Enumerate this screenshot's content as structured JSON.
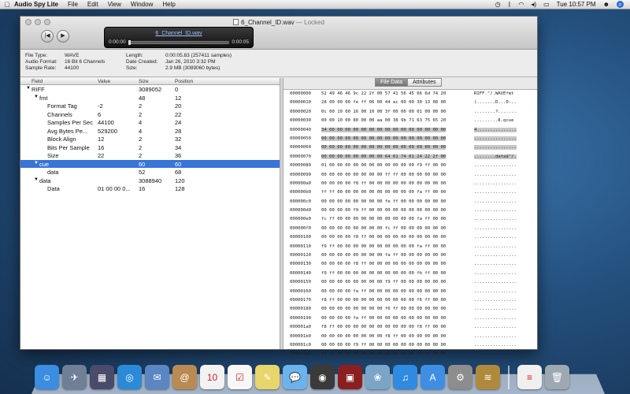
{
  "menubar": {
    "app_name": "Audio Spy Lite",
    "menus": [
      "File",
      "Edit",
      "View",
      "Window",
      "Help"
    ],
    "clock": "Tue 10:57 PM"
  },
  "window": {
    "title": "6_Channel_ID.wav",
    "title_suffix": "— Locked"
  },
  "player": {
    "file_name": "6_Channel_ID.wav",
    "current_time": "0:00:00",
    "total_time": "0:00:05",
    "progress": 0.0
  },
  "info": {
    "file_type_label": "File Type:",
    "file_type": "WAVE",
    "audio_format_label": "Audio Format:",
    "audio_format": "16 Bit 6 Channels",
    "sample_rate_label": "Sample Rate:",
    "sample_rate": "44100",
    "length_label": "Length:",
    "length": "0:00:05.83 (257411 samples)",
    "date_label": "Date Created:",
    "date": "Jan 26, 2010 3:32 PM",
    "size_label": "Size:",
    "size": "2.9 MB (3089060 bytes)"
  },
  "tree": {
    "columns": [
      "Field",
      "Value",
      "Size",
      "Position"
    ],
    "rows": [
      {
        "field": "RIFF",
        "value": "",
        "size": "3089052",
        "position": "0",
        "indent": 0,
        "toggle": "▼"
      },
      {
        "field": "fmt",
        "value": "",
        "size": "48",
        "position": "12",
        "indent": 1,
        "toggle": "▼"
      },
      {
        "field": "Format Tag",
        "value": "-2",
        "size": "2",
        "position": "20",
        "indent": 2,
        "toggle": ""
      },
      {
        "field": "Channels",
        "value": "6",
        "size": "2",
        "position": "22",
        "indent": 2,
        "toggle": ""
      },
      {
        "field": "Samples Per Sec",
        "value": "44100",
        "size": "4",
        "position": "24",
        "indent": 2,
        "toggle": ""
      },
      {
        "field": "Avg Bytes Pe...",
        "value": "529200",
        "size": "4",
        "position": "28",
        "indent": 2,
        "toggle": ""
      },
      {
        "field": "Block Align",
        "value": "12",
        "size": "2",
        "position": "32",
        "indent": 2,
        "toggle": ""
      },
      {
        "field": "Bits Per Sample",
        "value": "16",
        "size": "2",
        "position": "34",
        "indent": 2,
        "toggle": ""
      },
      {
        "field": "Size",
        "value": "22",
        "size": "2",
        "position": "36",
        "indent": 2,
        "toggle": ""
      },
      {
        "field": "cue",
        "value": "",
        "size": "60",
        "position": "60",
        "indent": 1,
        "toggle": "▼",
        "selected": true
      },
      {
        "field": "data",
        "value": "",
        "size": "52",
        "position": "68",
        "indent": 2,
        "toggle": ""
      },
      {
        "field": "data",
        "value": "",
        "size": "3088940",
        "position": "120",
        "indent": 1,
        "toggle": "▼"
      },
      {
        "field": "Data",
        "value": "01 00 00 0...",
        "size": "16",
        "position": "128",
        "indent": 2,
        "toggle": ""
      }
    ]
  },
  "tabs": {
    "file_data": "File Data",
    "attributes": "Attributes"
  },
  "hex": {
    "rows": [
      {
        "offset": "00000000",
        "bytes": "52 49 46 46 9c 22 2f 00 57 41 56 45 66 6d 74 20",
        "ascii": "RIFF.\"/.WAVEfmt "
      },
      {
        "offset": "00000010",
        "bytes": "28 00 00 00 fe ff 06 00 44 ac 00 00 30 13 08 00",
        "ascii": "(.......D...0..."
      },
      {
        "offset": "00000020",
        "bytes": "0c 00 10 00 16 00 10 00 3f 00 00 00 01 00 00 00",
        "ascii": "........?......."
      },
      {
        "offset": "00000030",
        "bytes": "00 00 10 00 80 00 00 aa 00 38 9b 71 63 75 65 20",
        "ascii": ".........8.qcue "
      },
      {
        "offset": "00000040",
        "bytes": "34 00 00 00 00 00 00 00 00 00 00 00 00 00 00 00",
        "ascii": "4..............."
      },
      {
        "offset": "00000050",
        "bytes": "00 00 00 00 00 00 00 00 00 00 00 00 00 00 00 00",
        "ascii": "................"
      },
      {
        "offset": "00000060",
        "bytes": "00 00 00 00 00 00 00 00 00 00 00 00 00 00 00 00",
        "ascii": "................"
      },
      {
        "offset": "00000070",
        "bytes": "00 00 00 00 00 00 00 00 64 61 74 61 24 22 2f 00",
        "ascii": "........data$\"/."
      },
      {
        "offset": "00000080",
        "bytes": "01 00 00 00 00 00 00 00 00 00 00 00 f9 ff 00 00",
        "ascii": "................"
      },
      {
        "offset": "00000090",
        "bytes": "00 00 00 00 00 00 00 00 ff ff 00 00 00 00 00 00",
        "ascii": "................"
      },
      {
        "offset": "000000a0",
        "bytes": "00 00 00 00 f8 ff 00 00 00 00 00 00 00 00 00 00",
        "ascii": "................"
      },
      {
        "offset": "000000b0",
        "bytes": "ff ff 00 00 00 00 00 00 00 00 00 00 fa ff 00 00",
        "ascii": "................"
      },
      {
        "offset": "000000c0",
        "bytes": "00 00 00 00 00 00 00 00 fe ff 00 00 00 00 00 00",
        "ascii": "................"
      },
      {
        "offset": "000000d0",
        "bytes": "00 00 00 00 f9 ff 00 00 00 00 00 00 00 00 00 00",
        "ascii": "................"
      },
      {
        "offset": "000000e0",
        "bytes": "fc ff 00 00 00 00 00 00 00 00 00 00 fa ff 00 00",
        "ascii": "................"
      },
      {
        "offset": "000000f0",
        "bytes": "00 00 00 00 00 00 00 00 fc ff 00 00 00 00 00 00",
        "ascii": "................"
      },
      {
        "offset": "00000100",
        "bytes": "00 00 00 00 f8 ff 00 00 00 00 00 00 00 00 00 00",
        "ascii": "................"
      },
      {
        "offset": "00000110",
        "bytes": "f9 ff 00 00 00 00 00 00 00 00 00 00 fa ff 00 00",
        "ascii": "................"
      },
      {
        "offset": "00000120",
        "bytes": "00 00 00 00 00 00 00 00 fa ff 00 00 00 00 00 00",
        "ascii": "................"
      },
      {
        "offset": "00000130",
        "bytes": "00 00 00 00 f8 ff 00 00 00 00 00 00 00 00 00 00",
        "ascii": "................"
      },
      {
        "offset": "00000140",
        "bytes": "f9 ff 00 00 00 00 00 00 00 00 00 00 fb ff 00 00",
        "ascii": "................"
      },
      {
        "offset": "00000150",
        "bytes": "00 00 00 00 00 00 00 00 f9 ff 00 00 00 00 00 00",
        "ascii": "................"
      },
      {
        "offset": "00000160",
        "bytes": "00 00 00 00 fa ff 00 00 00 00 00 00 00 00 00 00",
        "ascii": "................"
      },
      {
        "offset": "00000170",
        "bytes": "f8 ff 00 00 00 00 00 00 00 00 00 00 f6 ff 00 00",
        "ascii": "................"
      },
      {
        "offset": "00000180",
        "bytes": "00 00 00 00 00 00 00 00 f6 ff 00 00 00 00 00 00",
        "ascii": "................"
      },
      {
        "offset": "00000190",
        "bytes": "00 00 00 00 fa ff 00 00 00 00 00 00 00 00 00 00",
        "ascii": "................"
      },
      {
        "offset": "000001a0",
        "bytes": "f8 ff 00 00 00 00 00 00 00 00 00 00 f8 ff 00 00",
        "ascii": "................"
      },
      {
        "offset": "000001b0",
        "bytes": "00 00 00 00 00 00 00 00 f8 ff 00 00 00 00 00 00",
        "ascii": "................"
      },
      {
        "offset": "000001c0",
        "bytes": "00 00 00 00 f9 ff 00 00 00 00 00 00 00 00 00 00",
        "ascii": "................"
      },
      {
        "offset": "000001d0",
        "bytes": "f8 ff 00 00 00 00 00 00 00 00 00 00 f9 ff 00 00",
        "ascii": "................"
      }
    ],
    "highlight_rows": [
      4,
      5,
      6,
      7
    ]
  },
  "dock": {
    "items": [
      {
        "name": "finder-icon",
        "color": "#3a8de0",
        "glyph": "☺"
      },
      {
        "name": "launchpad-icon",
        "color": "#6f7f95",
        "glyph": "✈"
      },
      {
        "name": "mission-control-icon",
        "color": "#4a4a6a",
        "glyph": "▦"
      },
      {
        "name": "safari-icon",
        "color": "#2b8ad8",
        "glyph": "◎"
      },
      {
        "name": "mail-icon",
        "color": "#5b86c2",
        "glyph": "✉"
      },
      {
        "name": "contacts-icon",
        "color": "#b98b52",
        "glyph": "@"
      },
      {
        "name": "calendar-icon",
        "color": "#f2f2f2",
        "glyph": "10"
      },
      {
        "name": "reminders-icon",
        "color": "#f7f7f7",
        "glyph": "☑"
      },
      {
        "name": "notes-icon",
        "color": "#e8d56b",
        "glyph": "✎"
      },
      {
        "name": "messages-icon",
        "color": "#6ab3ec",
        "glyph": "💬"
      },
      {
        "name": "facetime-icon",
        "color": "#3a3a3a",
        "glyph": "◉"
      },
      {
        "name": "photo-booth-icon",
        "color": "#8b1f1f",
        "glyph": "▣"
      },
      {
        "name": "iphoto-icon",
        "color": "#7aa5c9",
        "glyph": "❀"
      },
      {
        "name": "itunes-icon",
        "color": "#2f8be0",
        "glyph": "♫"
      },
      {
        "name": "app-store-icon",
        "color": "#3e8fe3",
        "glyph": "A"
      },
      {
        "name": "system-preferences-icon",
        "color": "#8d8d8d",
        "glyph": "⚙"
      },
      {
        "name": "audio-spy-icon",
        "color": "#b08a3c",
        "glyph": "≋"
      },
      {
        "name": "document-icon",
        "color": "#f0f0f0",
        "glyph": "≡"
      },
      {
        "name": "trash-icon",
        "color": "#9ea8b0",
        "glyph": "🗑"
      }
    ]
  }
}
